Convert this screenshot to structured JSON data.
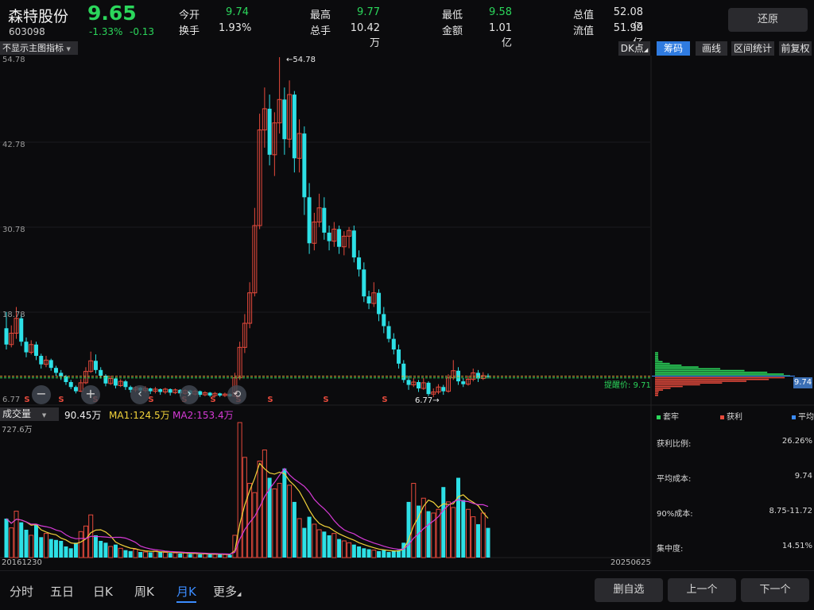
{
  "stock": {
    "name": "森特股份",
    "code": "603098",
    "price": "9.65",
    "change_pct": "-1.33%",
    "change": "-0.13"
  },
  "quote": [
    {
      "label": "今开",
      "value": "9.74",
      "color": "#2bd65b"
    },
    {
      "label": "换手",
      "value": "1.93%",
      "color": "#e6e6e6"
    },
    {
      "label": "最高",
      "value": "9.77",
      "color": "#2bd65b"
    },
    {
      "label": "总手",
      "value": "10.42万",
      "color": "#e6e6e6"
    },
    {
      "label": "最低",
      "value": "9.58",
      "color": "#2bd65b"
    },
    {
      "label": "金额",
      "value": "1.01亿",
      "color": "#e6e6e6"
    },
    {
      "label": "总值",
      "value": "52.08亿",
      "color": "#e6e6e6"
    },
    {
      "label": "流值",
      "value": "51.99亿",
      "color": "#e6e6e6"
    }
  ],
  "restore_label": "还原",
  "indicator_select": "不显示主图指标",
  "dk_label": "DK点",
  "side_tabs": [
    "筹码",
    "画线",
    "区间统计",
    "前复权"
  ],
  "active_side_tab": 0,
  "price_axis": [
    "54.78",
    "42.78",
    "30.78",
    "18.78",
    "6.77"
  ],
  "max_price_label": "54.78",
  "min_price_label": "6.77",
  "alert_label": "提醒价: 9.71",
  "chip_price": "9.74",
  "volume": {
    "select": "成交量",
    "value": "90.45万",
    "ma1": "MA1:124.5万",
    "ma2": "MA2:153.4万",
    "axis_top": "727.6万"
  },
  "date_start": "20161230",
  "date_end": "20250625",
  "legend": [
    {
      "label": "套牢",
      "color": "#2bd65b"
    },
    {
      "label": "获利",
      "color": "#e64a3c"
    },
    {
      "label": "平均",
      "color": "#3b8cff"
    }
  ],
  "stats": [
    {
      "label": "获利比例:",
      "value": "26.26%"
    },
    {
      "label": "平均成本:",
      "value": "9.74"
    },
    {
      "label": "90%成本:",
      "value": "8.75-11.72"
    },
    {
      "label": "集中度:",
      "value": "14.51%"
    }
  ],
  "bottom_tabs": [
    "分时",
    "五日",
    "日K",
    "周K",
    "月K",
    "更多"
  ],
  "active_bottom_tab": 4,
  "nav_buttons": [
    "删自选",
    "上一个",
    "下一个"
  ],
  "colors": {
    "up": "#e64a3c",
    "down": "#2de0e6",
    "ma1": "#f2d23a",
    "ma2": "#d63ad6",
    "alert": "#2bd65b"
  },
  "chart_data": {
    "type": "candlestick",
    "price_range": [
      6.77,
      54.78
    ],
    "volume_range": [
      0,
      727.6
    ],
    "candles": [
      [
        16.5,
        14.2,
        18.8,
        13.5
      ],
      [
        14.2,
        15.8,
        16.9,
        13.8
      ],
      [
        15.8,
        17.9,
        19.5,
        15.0
      ],
      [
        17.9,
        14.6,
        18.5,
        14.0
      ],
      [
        14.6,
        13.1,
        15.2,
        12.4
      ],
      [
        13.1,
        14.2,
        14.8,
        12.8
      ],
      [
        14.2,
        12.6,
        14.6,
        12.0
      ],
      [
        12.6,
        11.4,
        12.9,
        10.8
      ],
      [
        11.4,
        12.0,
        12.6,
        11.0
      ],
      [
        12.0,
        10.9,
        12.2,
        10.5
      ],
      [
        10.9,
        10.2,
        11.2,
        9.8
      ],
      [
        10.2,
        9.7,
        10.6,
        9.2
      ],
      [
        9.7,
        8.9,
        9.9,
        8.5
      ],
      [
        8.9,
        8.2,
        9.2,
        7.9
      ],
      [
        8.2,
        7.6,
        8.4,
        7.3
      ],
      [
        7.6,
        8.8,
        9.3,
        7.5
      ],
      [
        8.8,
        10.4,
        11.0,
        8.6
      ],
      [
        10.4,
        11.9,
        13.2,
        10.2
      ],
      [
        11.9,
        10.6,
        12.8,
        10.1
      ],
      [
        10.6,
        9.8,
        11.0,
        9.4
      ],
      [
        9.8,
        8.7,
        10.0,
        8.3
      ],
      [
        8.7,
        9.4,
        9.8,
        8.5
      ],
      [
        9.4,
        8.4,
        9.6,
        8.0
      ],
      [
        8.4,
        9.0,
        9.3,
        8.2
      ],
      [
        9.0,
        8.2,
        9.2,
        7.8
      ],
      [
        8.2,
        7.8,
        8.4,
        7.4
      ],
      [
        7.8,
        8.1,
        8.3,
        7.5
      ],
      [
        8.1,
        7.7,
        8.2,
        7.3
      ],
      [
        7.7,
        8.0,
        8.3,
        7.4
      ],
      [
        8.0,
        7.6,
        8.1,
        7.2
      ],
      [
        7.6,
        7.9,
        8.2,
        7.3
      ],
      [
        7.9,
        7.5,
        8.0,
        7.1
      ],
      [
        7.5,
        7.9,
        8.1,
        7.2
      ],
      [
        7.9,
        7.4,
        8.0,
        7.0
      ],
      [
        7.4,
        7.8,
        8.0,
        7.2
      ],
      [
        7.8,
        7.3,
        7.9,
        6.9
      ],
      [
        7.3,
        7.7,
        7.9,
        7.1
      ],
      [
        7.7,
        7.2,
        7.8,
        6.9
      ],
      [
        7.2,
        7.6,
        7.8,
        7.0
      ],
      [
        7.6,
        7.1,
        7.7,
        6.8
      ],
      [
        7.1,
        7.4,
        7.6,
        6.9
      ],
      [
        7.4,
        7.0,
        7.5,
        6.8
      ],
      [
        7.0,
        7.3,
        7.5,
        6.8
      ],
      [
        7.3,
        7.0,
        7.4,
        6.8
      ],
      [
        7.0,
        7.2,
        7.4,
        6.8
      ],
      [
        7.2,
        6.9,
        7.3,
        6.8
      ],
      [
        6.9,
        9.5,
        10.2,
        6.8
      ],
      [
        9.5,
        13.8,
        14.6,
        9.2
      ],
      [
        13.8,
        17.2,
        18.5,
        13.0
      ],
      [
        17.2,
        21.5,
        23.0,
        16.5
      ],
      [
        21.5,
        31.0,
        33.5,
        21.0
      ],
      [
        31.0,
        44.5,
        46.8,
        30.5
      ],
      [
        44.5,
        47.5,
        50.5,
        42.0
      ],
      [
        47.5,
        41.0,
        49.5,
        39.5
      ],
      [
        41.0,
        45.5,
        47.0,
        38.0
      ],
      [
        45.5,
        48.8,
        54.78,
        44.0
      ],
      [
        48.8,
        43.2,
        50.5,
        41.0
      ],
      [
        43.2,
        49.5,
        51.5,
        42.0
      ],
      [
        49.5,
        40.5,
        50.0,
        38.5
      ],
      [
        40.5,
        44.0,
        46.0,
        38.5
      ],
      [
        44.0,
        35.0,
        45.0,
        32.5
      ],
      [
        35.0,
        28.5,
        37.0,
        27.0
      ],
      [
        28.5,
        31.5,
        32.8,
        27.5
      ],
      [
        31.5,
        33.5,
        35.5,
        30.8
      ],
      [
        33.5,
        30.0,
        35.0,
        29.0
      ],
      [
        30.0,
        28.8,
        31.0,
        27.5
      ],
      [
        28.8,
        30.5,
        31.5,
        28.0
      ],
      [
        30.5,
        28.0,
        31.0,
        27.0
      ],
      [
        28.0,
        29.5,
        30.2,
        26.8
      ],
      [
        29.5,
        30.3,
        30.8,
        27.8
      ],
      [
        30.3,
        26.5,
        31.0,
        25.8
      ],
      [
        26.5,
        24.8,
        27.5,
        23.8
      ],
      [
        24.8,
        21.0,
        25.8,
        20.2
      ],
      [
        21.0,
        20.0,
        21.8,
        19.2
      ],
      [
        20.0,
        21.5,
        23.0,
        19.5
      ],
      [
        21.5,
        18.5,
        22.0,
        17.5
      ],
      [
        18.5,
        16.8,
        19.5,
        15.8
      ],
      [
        16.8,
        15.0,
        17.5,
        14.5
      ],
      [
        15.0,
        13.5,
        15.8,
        12.8
      ],
      [
        13.5,
        11.5,
        14.2,
        10.8
      ],
      [
        11.5,
        9.2,
        12.0,
        8.8
      ],
      [
        9.2,
        8.5,
        9.8,
        7.8
      ],
      [
        8.5,
        8.9,
        9.5,
        8.2
      ],
      [
        8.9,
        8.0,
        9.2,
        7.5
      ],
      [
        8.0,
        8.8,
        9.5,
        7.8
      ],
      [
        8.8,
        7.2,
        9.0,
        6.9
      ],
      [
        7.2,
        7.5,
        8.0,
        6.77
      ],
      [
        7.5,
        8.2,
        8.6,
        7.2
      ],
      [
        8.2,
        7.6,
        8.5,
        7.1
      ],
      [
        7.6,
        9.5,
        10.0,
        7.4
      ],
      [
        9.5,
        10.5,
        12.0,
        9.2
      ],
      [
        10.5,
        9.0,
        11.0,
        8.5
      ],
      [
        9.0,
        8.6,
        9.5,
        8.2
      ],
      [
        8.6,
        9.3,
        9.8,
        8.4
      ],
      [
        9.3,
        10.2,
        10.8,
        9.0
      ],
      [
        10.2,
        9.4,
        10.6,
        8.9
      ],
      [
        9.4,
        9.8,
        10.3,
        9.2
      ],
      [
        9.8,
        9.65,
        10.1,
        9.4
      ]
    ],
    "volumes": [
      210,
      160,
      250,
      190,
      150,
      120,
      180,
      110,
      130,
      100,
      95,
      90,
      60,
      50,
      80,
      140,
      170,
      230,
      120,
      90,
      80,
      60,
      70,
      50,
      40,
      35,
      45,
      30,
      30,
      28,
      35,
      30,
      28,
      25,
      25,
      22,
      25,
      20,
      22,
      18,
      20,
      18,
      17,
      18,
      16,
      15,
      120,
      727.6,
      540,
      400,
      350,
      520,
      580,
      430,
      370,
      400,
      480,
      390,
      300,
      210,
      160,
      220,
      180,
      150,
      140,
      120,
      130,
      100,
      90,
      80,
      70,
      60,
      50,
      45,
      40,
      35,
      40,
      30,
      35,
      40,
      80,
      300,
      400,
      280,
      320,
      250,
      240,
      260,
      380,
      300,
      270,
      430,
      310,
      260,
      220,
      180,
      240,
      160
    ]
  }
}
